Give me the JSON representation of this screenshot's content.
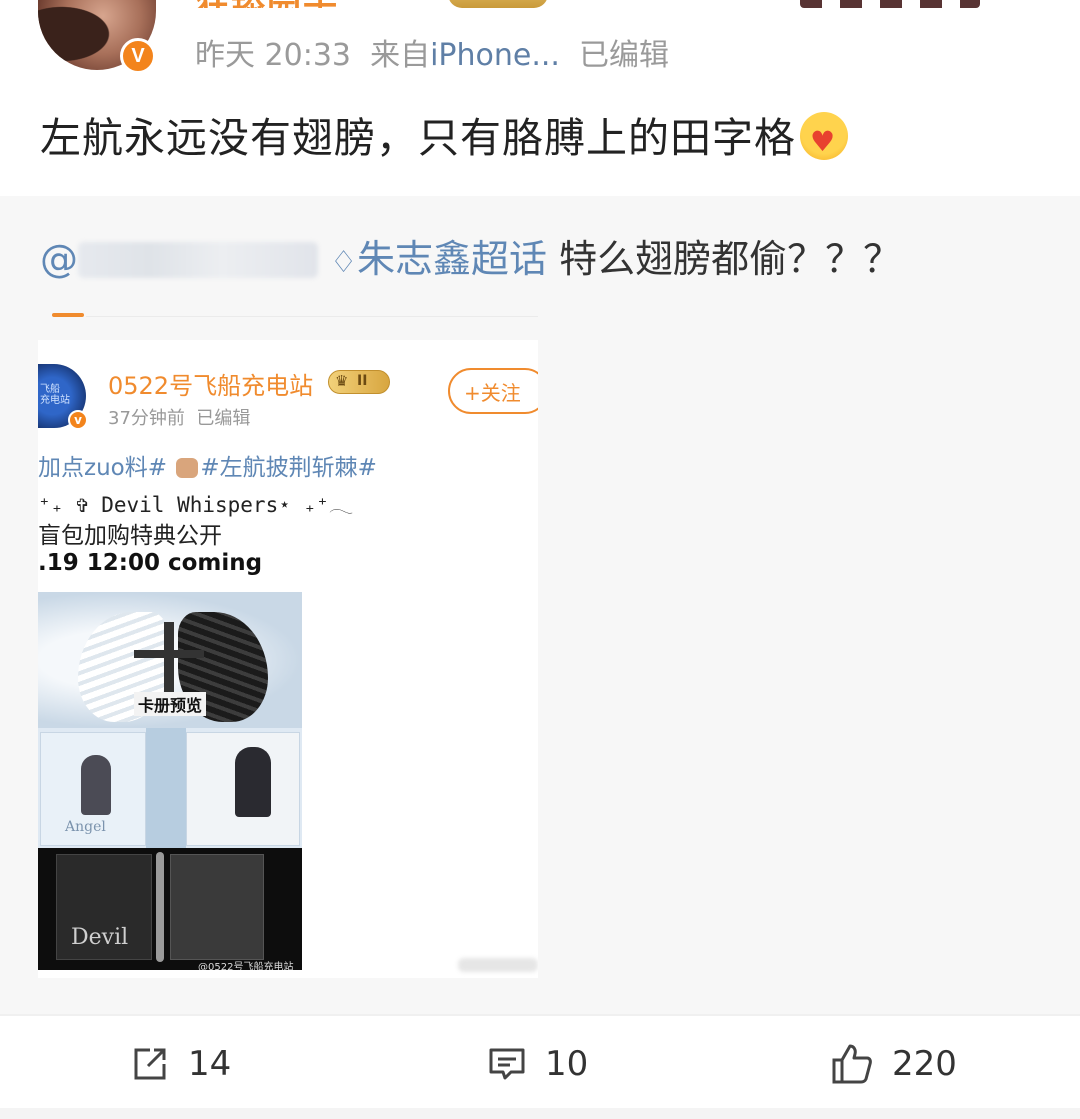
{
  "post": {
    "nickname_partial": "狂舔园子",
    "time": "昨天 20:33",
    "source_prefix": "来自",
    "source": "iPhone...",
    "edited": "已编辑",
    "text": "左航永远没有翅膀，只有胳膊上的田字格"
  },
  "repost": {
    "at": "@",
    "topic": "朱志鑫超话",
    "comment": " 特么翅膀都偷？？？"
  },
  "embedded": {
    "account_name": "0522号飞船充电站",
    "badge_level": "II",
    "follow_label": "+关注",
    "time": "37分钟前",
    "edited": "已编辑",
    "line1_a": "加点zuo料# ",
    "line1_b": "#左航披荆斩棘#",
    "line2": "⁺₊ ✞ Devil Whispers⋆ ₊⁺𓂃",
    "line3": "盲包加购特典公开",
    "line4": ".19 12:00 coming",
    "promo_tag": "卡册预览",
    "label_angel": "Angel",
    "label_devil": "Devil",
    "watermark": "@0522号飞船充电站"
  },
  "actions": {
    "share_count": "14",
    "comment_count": "10",
    "like_count": "220"
  },
  "colors": {
    "accent_orange": "#f08b2e",
    "link_blue": "#5f87b5",
    "meta_gray": "#9a9a9a"
  }
}
